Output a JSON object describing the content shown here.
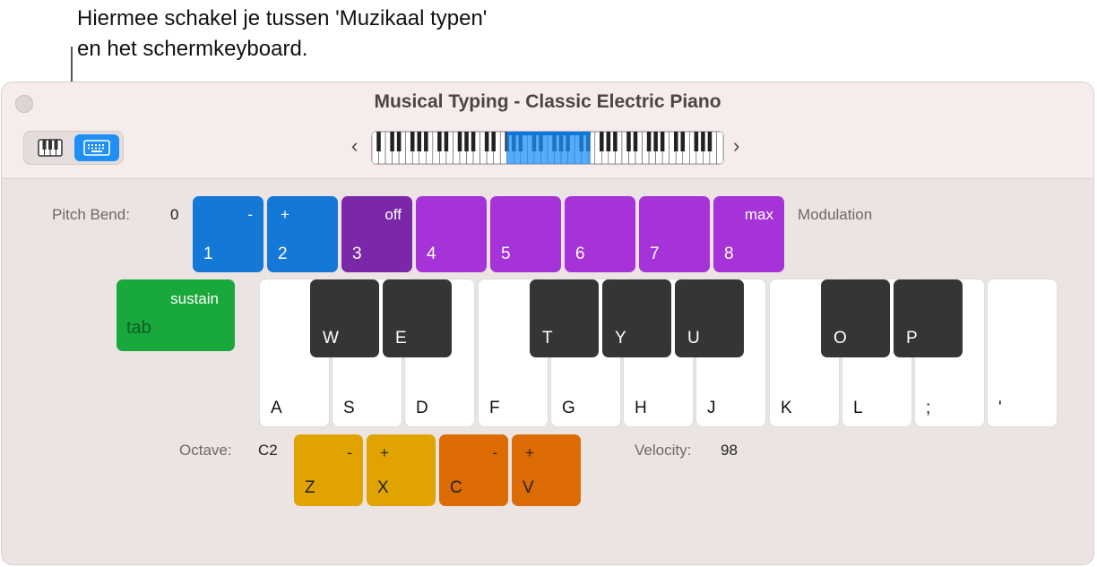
{
  "callout": {
    "line1": "Hiermee schakel je tussen 'Muzikaal typen'",
    "line2": "en het schermkeyboard."
  },
  "window": {
    "title": "Musical Typing - Classic Electric Piano",
    "prev_arrow": "‹",
    "next_arrow": "›"
  },
  "pitch_bend": {
    "label": "Pitch Bend:",
    "value": "0"
  },
  "modulation": {
    "label": "Modulation"
  },
  "top_keys": [
    {
      "top": "-",
      "bottom": "1",
      "color": "#1478d6"
    },
    {
      "top": "+",
      "bottom": "2",
      "color": "#1478d6"
    },
    {
      "top": "off",
      "bottom": "3",
      "color": "#7a27a8"
    },
    {
      "top": "",
      "bottom": "4",
      "color": "#a533d8"
    },
    {
      "top": "",
      "bottom": "5",
      "color": "#a533d8"
    },
    {
      "top": "",
      "bottom": "6",
      "color": "#a533d8"
    },
    {
      "top": "",
      "bottom": "7",
      "color": "#a533d8"
    },
    {
      "top": "max",
      "bottom": "8",
      "color": "#a533d8"
    }
  ],
  "sustain": {
    "top": "sustain",
    "bottom": "tab",
    "color": "#19a83c"
  },
  "white_keys": [
    "A",
    "S",
    "D",
    "F",
    "G",
    "H",
    "J",
    "K",
    "L",
    ";",
    "'"
  ],
  "black_keys": [
    "W",
    "E",
    "T",
    "Y",
    "U",
    "O",
    "P"
  ],
  "octave": {
    "label": "Octave:",
    "value": "C2"
  },
  "velocity": {
    "label": "Velocity:",
    "value": "98"
  },
  "bottom_keys": [
    {
      "top": "-",
      "bottom": "Z",
      "color": "#e0a300"
    },
    {
      "top": "+",
      "bottom": "X",
      "color": "#e0a300"
    },
    {
      "top": "-",
      "bottom": "C",
      "color": "#dd6b04"
    },
    {
      "top": "+",
      "bottom": "V",
      "color": "#dd6b04"
    }
  ],
  "icons": {
    "piano_view": "piano-keyboard-icon",
    "typing_view": "computer-keyboard-icon",
    "close": "close-icon"
  },
  "colors": {
    "accent": "#1f8ff5"
  }
}
